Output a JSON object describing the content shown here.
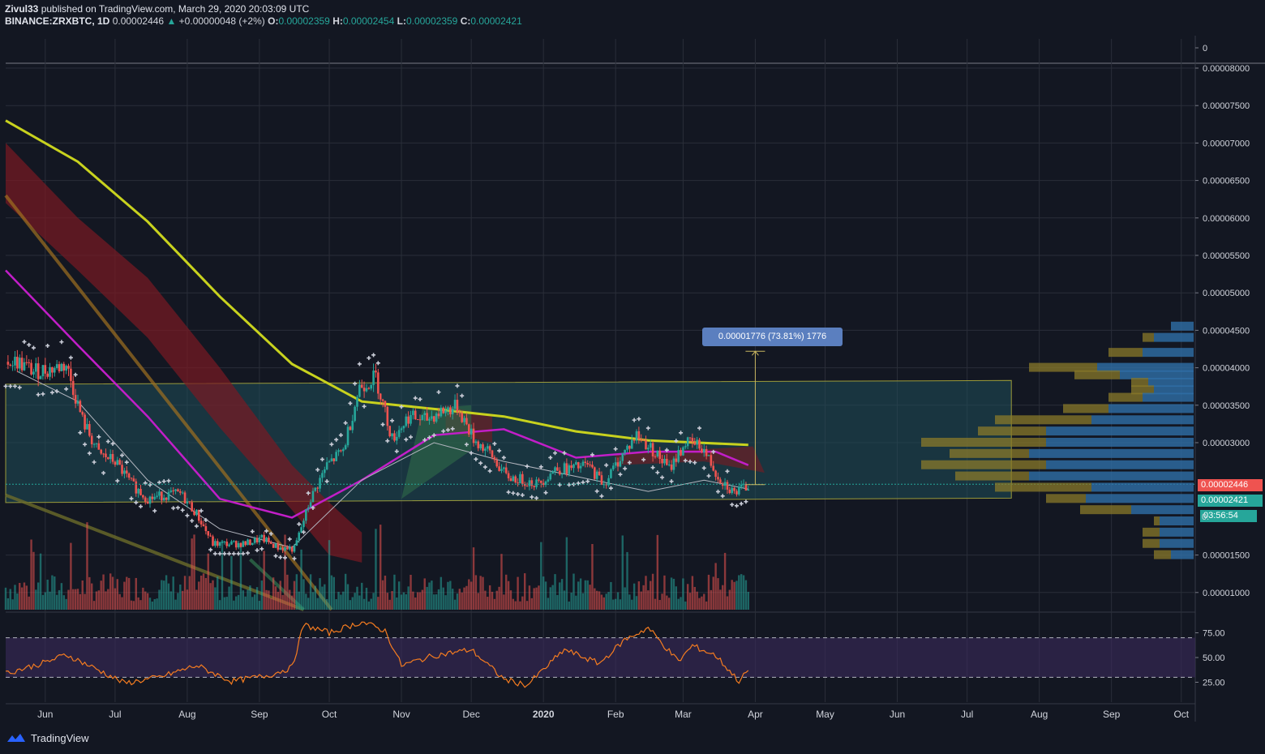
{
  "header": {
    "publisher": "Zivul33",
    "published_text": "published on TradingView.com, March 29, 2020 20:03:09 UTC",
    "symbol": "BINANCE:ZRXBTC, 1D",
    "last": "0.00002446",
    "change": "+0.00000048 (+2%)",
    "o_label": "O:",
    "o_value": "0.00002359",
    "h_label": "H:",
    "h_value": "0.00002454",
    "l_label": "L:",
    "l_value": "0.00002359",
    "c_label": "C:",
    "c_value": "0.00002421"
  },
  "measure_label": "0.00001776 (73.81%) 1776",
  "price_tags": {
    "last_price": "0.00002446",
    "close_price": "0.00002421",
    "countdown": "03:56:54",
    "partial": "0."
  },
  "footer": {
    "brand": "TradingView"
  },
  "colors": {
    "bg": "#131722",
    "grid": "#2a2e39",
    "up": "#26a69a",
    "down": "#ef5350",
    "ma200": "#c8d21e",
    "ma50": "#c21ec8",
    "ma20": "#b2b5be",
    "channel": "#1f4e5a",
    "cloud_bear": "#7a1a22",
    "cloud_bull": "#2e6b4a",
    "rsi": "#f57c20",
    "rsi_band": "#3b2a5c",
    "vp_up": "#2f6fa8",
    "vp_down": "#8a7a2a",
    "measure": "#5b7fbf",
    "trend_orange": "#a07020"
  },
  "chart_data": {
    "type": "candlestick",
    "symbol": "BINANCE:ZRXBTC",
    "interval": "1D",
    "price_axis_labels": [
      "0",
      "0.00008000",
      "0.00007500",
      "0.00007000",
      "0.00006500",
      "0.00006000",
      "0.00005500",
      "0.00005000",
      "0.00004500",
      "0.00004000",
      "0.00003500",
      "0.00003000",
      "0.00001500",
      "0.00001000"
    ],
    "price_axis_values": [
      null,
      8e-05,
      7.5e-05,
      7e-05,
      6.5e-05,
      6e-05,
      5.5e-05,
      5e-05,
      4.5e-05,
      4e-05,
      3.5e-05,
      3e-05,
      1.5e-05,
      1e-05
    ],
    "time_axis_labels": [
      "Jun",
      "Jul",
      "Aug",
      "Sep",
      "Oct",
      "Nov",
      "Dec",
      "2020",
      "Feb",
      "Mar",
      "Apr",
      "May",
      "Jun",
      "Jul",
      "Aug",
      "Sep",
      "Oct"
    ],
    "rsi_axis_labels": [
      "75.00",
      "50.00",
      "25.00"
    ],
    "rsi_levels": [
      70,
      30
    ],
    "close_path": [
      [
        "2019-05-20",
        4.08e-05
      ],
      [
        "2019-05-27",
        3.95e-05
      ],
      [
        "2019-06-03",
        3.98e-05
      ],
      [
        "2019-06-10",
        4.04e-05
      ],
      [
        "2019-06-17",
        3.3e-05
      ],
      [
        "2019-06-24",
        2.85e-05
      ],
      [
        "2019-07-01",
        2.75e-05
      ],
      [
        "2019-07-08",
        2.45e-05
      ],
      [
        "2019-07-15",
        2.25e-05
      ],
      [
        "2019-07-22",
        2.3e-05
      ],
      [
        "2019-07-29",
        2.32e-05
      ],
      [
        "2019-08-05",
        2.05e-05
      ],
      [
        "2019-08-12",
        1.65e-05
      ],
      [
        "2019-08-19",
        1.65e-05
      ],
      [
        "2019-08-26",
        1.65e-05
      ],
      [
        "2019-09-02",
        1.72e-05
      ],
      [
        "2019-09-09",
        1.6e-05
      ],
      [
        "2019-09-16",
        1.58e-05
      ],
      [
        "2019-09-23",
        2.25e-05
      ],
      [
        "2019-09-30",
        2.7e-05
      ],
      [
        "2019-10-07",
        2.9e-05
      ],
      [
        "2019-10-14",
        3.75e-05
      ],
      [
        "2019-10-21",
        3.88e-05
      ],
      [
        "2019-10-28",
        3.05e-05
      ],
      [
        "2019-11-04",
        3.35e-05
      ],
      [
        "2019-11-11",
        3.3e-05
      ],
      [
        "2019-11-18",
        3.42e-05
      ],
      [
        "2019-11-25",
        3.48e-05
      ],
      [
        "2019-12-02",
        3.05e-05
      ],
      [
        "2019-12-09",
        2.85e-05
      ],
      [
        "2019-12-16",
        2.55e-05
      ],
      [
        "2019-12-23",
        2.5e-05
      ],
      [
        "2019-12-30",
        2.45e-05
      ],
      [
        "2020-01-06",
        2.65e-05
      ],
      [
        "2020-01-13",
        2.65e-05
      ],
      [
        "2020-01-20",
        2.7e-05
      ],
      [
        "2020-01-27",
        2.45e-05
      ],
      [
        "2020-02-03",
        2.8e-05
      ],
      [
        "2020-02-10",
        3.1e-05
      ],
      [
        "2020-02-17",
        2.9e-05
      ],
      [
        "2020-02-24",
        2.65e-05
      ],
      [
        "2020-03-02",
        3e-05
      ],
      [
        "2020-03-09",
        2.95e-05
      ],
      [
        "2020-03-16",
        2.55e-05
      ],
      [
        "2020-03-23",
        2.33e-05
      ],
      [
        "2020-03-29",
        2.42e-05
      ]
    ],
    "ma200": [
      [
        "2019-05-15",
        7.3e-05
      ],
      [
        "2019-06-15",
        6.75e-05
      ],
      [
        "2019-07-15",
        5.95e-05
      ],
      [
        "2019-08-15",
        4.95e-05
      ],
      [
        "2019-09-15",
        4.05e-05
      ],
      [
        "2019-10-15",
        3.55e-05
      ],
      [
        "2019-11-15",
        3.45e-05
      ],
      [
        "2019-12-15",
        3.35e-05
      ],
      [
        "2020-01-15",
        3.15e-05
      ],
      [
        "2020-02-15",
        3.03e-05
      ],
      [
        "2020-03-29",
        2.97e-05
      ]
    ],
    "ma50": [
      [
        "2019-05-15",
        5.3e-05
      ],
      [
        "2019-06-15",
        4.3e-05
      ],
      [
        "2019-07-15",
        3.35e-05
      ],
      [
        "2019-08-15",
        2.25e-05
      ],
      [
        "2019-09-15",
        2e-05
      ],
      [
        "2019-10-15",
        2.5e-05
      ],
      [
        "2019-11-15",
        3.1e-05
      ],
      [
        "2019-12-15",
        3.18e-05
      ],
      [
        "2020-01-15",
        2.8e-05
      ],
      [
        "2020-02-15",
        2.88e-05
      ],
      [
        "2020-03-15",
        2.88e-05
      ],
      [
        "2020-03-29",
        2.7e-05
      ]
    ],
    "ma20": [
      [
        "2019-05-20",
        3.95e-05
      ],
      [
        "2019-06-15",
        3.55e-05
      ],
      [
        "2019-07-15",
        2.5e-05
      ],
      [
        "2019-08-15",
        1.85e-05
      ],
      [
        "2019-09-15",
        1.6e-05
      ],
      [
        "2019-10-15",
        2.5e-05
      ],
      [
        "2019-11-15",
        3e-05
      ],
      [
        "2019-12-15",
        2.75e-05
      ],
      [
        "2020-01-15",
        2.55e-05
      ],
      [
        "2020-02-15",
        2.35e-05
      ],
      [
        "2020-03-10",
        2.5e-05
      ],
      [
        "2020-03-29",
        2.38e-05
      ]
    ],
    "channel": {
      "upper": [
        [
          "2019-05-15",
          3.78e-05
        ],
        [
          "2020-07-20",
          3.83e-05
        ]
      ],
      "lower": [
        [
          "2019-05-15",
          2.2e-05
        ],
        [
          "2020-07-20",
          2.26e-05
        ]
      ]
    },
    "measure": {
      "date": "2020-04-01",
      "from": 2.44e-05,
      "to": 4.22e-05,
      "label": "0.00001776 (73.81%) 1776"
    },
    "rsi": [
      [
        "2019-05-15",
        34
      ],
      [
        "2019-06-01",
        45
      ],
      [
        "2019-06-10",
        53
      ],
      [
        "2019-06-25",
        36
      ],
      [
        "2019-07-05",
        24
      ],
      [
        "2019-07-20",
        30
      ],
      [
        "2019-08-05",
        42
      ],
      [
        "2019-08-20",
        26
      ],
      [
        "2019-09-05",
        32
      ],
      [
        "2019-09-15",
        40
      ],
      [
        "2019-09-20",
        83
      ],
      [
        "2019-10-01",
        75
      ],
      [
        "2019-10-15",
        86
      ],
      [
        "2019-10-25",
        77
      ],
      [
        "2019-11-01",
        42
      ],
      [
        "2019-11-15",
        52
      ],
      [
        "2019-12-01",
        58
      ],
      [
        "2019-12-15",
        28
      ],
      [
        "2019-12-25",
        22
      ],
      [
        "2020-01-10",
        58
      ],
      [
        "2020-01-25",
        44
      ],
      [
        "2020-02-05",
        68
      ],
      [
        "2020-02-15",
        80
      ],
      [
        "2020-02-28",
        46
      ],
      [
        "2020-03-05",
        62
      ],
      [
        "2020-03-15",
        52
      ],
      [
        "2020-03-25",
        26
      ],
      [
        "2020-03-29",
        37
      ]
    ],
    "volume_profile": [
      {
        "price": 4.55e-05,
        "up": 0.2,
        "down": 0.0
      },
      {
        "price": 4.4e-05,
        "up": 0.35,
        "down": 0.1
      },
      {
        "price": 4.2e-05,
        "up": 0.45,
        "down": 0.3
      },
      {
        "price": 4e-05,
        "up": 0.85,
        "down": 0.6
      },
      {
        "price": 3.9e-05,
        "up": 0.65,
        "down": 0.4
      },
      {
        "price": 3.8e-05,
        "up": 0.4,
        "down": 0.15
      },
      {
        "price": 3.7e-05,
        "up": 0.35,
        "down": 0.2
      },
      {
        "price": 3.6e-05,
        "up": 0.45,
        "down": 0.3
      },
      {
        "price": 3.45e-05,
        "up": 0.75,
        "down": 0.4
      },
      {
        "price": 3.3e-05,
        "up": 0.9,
        "down": 0.85
      },
      {
        "price": 3.15e-05,
        "up": 1.3,
        "down": 0.6
      },
      {
        "price": 3e-05,
        "up": 1.3,
        "down": 1.1
      },
      {
        "price": 2.85e-05,
        "up": 1.45,
        "down": 0.7
      },
      {
        "price": 2.7e-05,
        "up": 1.3,
        "down": 1.1
      },
      {
        "price": 2.55e-05,
        "up": 1.45,
        "down": 0.65
      },
      {
        "price": 2.4e-05,
        "up": 0.9,
        "down": 0.85
      },
      {
        "price": 2.25e-05,
        "up": 0.95,
        "down": 0.35
      },
      {
        "price": 2.1e-05,
        "up": 0.55,
        "down": 0.45
      },
      {
        "price": 1.95e-05,
        "up": 0.3,
        "down": 0.05
      },
      {
        "price": 1.8e-05,
        "up": 0.3,
        "down": 0.15
      },
      {
        "price": 1.65e-05,
        "up": 0.3,
        "down": 0.15
      },
      {
        "price": 1.5e-05,
        "up": 0.2,
        "down": 0.15
      }
    ]
  }
}
